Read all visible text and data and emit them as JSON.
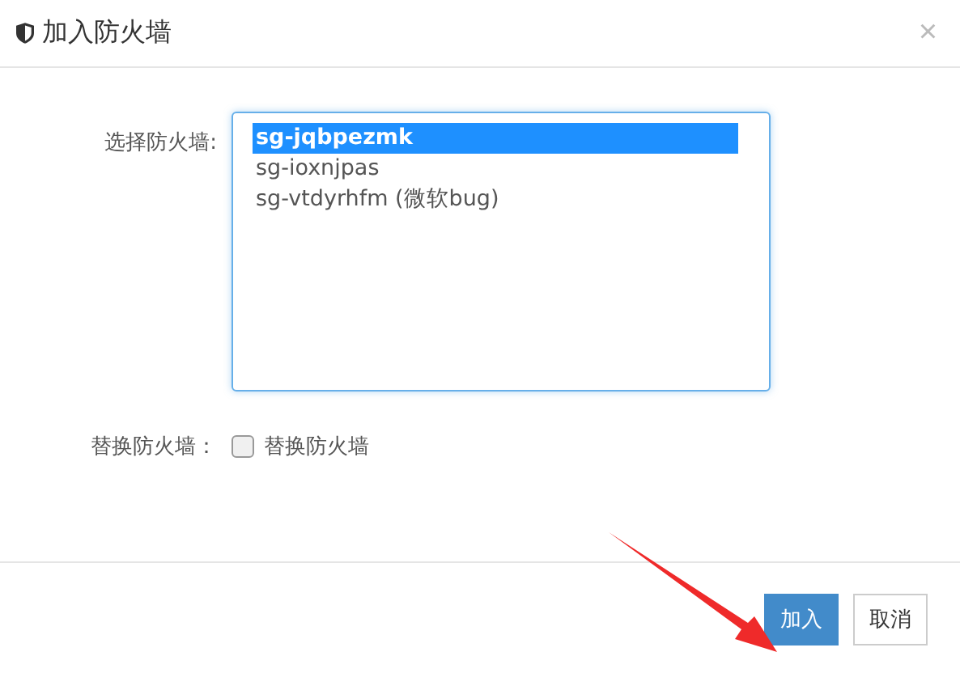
{
  "dialog": {
    "title": "加入防火墙",
    "close": "×"
  },
  "firewall_select": {
    "label": "选择防火墙:",
    "options": [
      {
        "text": "sg-jqbpezmk",
        "selected": true
      },
      {
        "text": "sg-ioxnjpas",
        "selected": false
      },
      {
        "text": "sg-vtdyrhfm (微软bug)",
        "selected": false
      }
    ]
  },
  "replace": {
    "label": "替换防火墙：",
    "checkbox_label": "替换防火墙",
    "checked": false
  },
  "buttons": [
    {
      "label": "加入",
      "kind": "primary"
    },
    {
      "label": "取消",
      "kind": "default"
    }
  ]
}
